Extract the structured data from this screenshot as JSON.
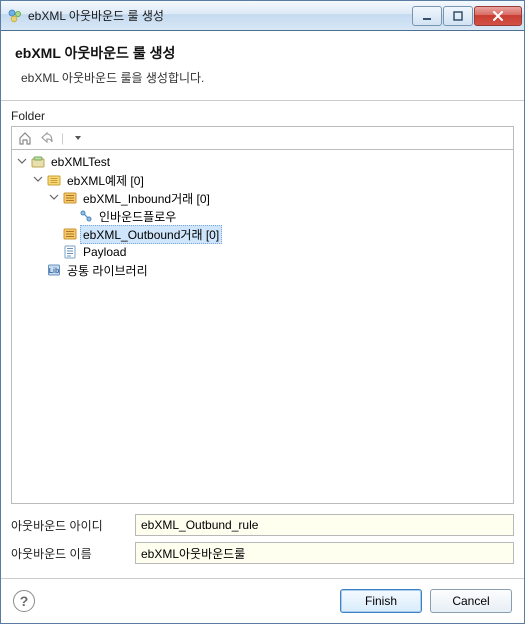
{
  "window": {
    "title": "ebXML 아웃바운드 룰 생성"
  },
  "header": {
    "title": "ebXML 아웃바운드 룰 생성",
    "subtitle": "ebXML 아웃바운드 룰을 생성합니다."
  },
  "folder": {
    "label": "Folder"
  },
  "tree": {
    "root": {
      "label": "ebXMLTest"
    },
    "example": {
      "label": "ebXML예제 [0]"
    },
    "inbound": {
      "label": "ebXML_Inbound거래 [0]"
    },
    "inboundflow": {
      "label": "인바운드플로우"
    },
    "outbound": {
      "label": "ebXML_Outbound거래 [0]"
    },
    "payload": {
      "label": "Payload"
    },
    "commonlib": {
      "label": "공통 라이브러리"
    }
  },
  "form": {
    "id": {
      "label": "아웃바운드 아이디",
      "value": "ebXML_Outbund_rule"
    },
    "name": {
      "label": "아웃바운드 이름",
      "value": "ebXML아웃바운드룰"
    }
  },
  "footer": {
    "finish": "Finish",
    "cancel": "Cancel"
  }
}
